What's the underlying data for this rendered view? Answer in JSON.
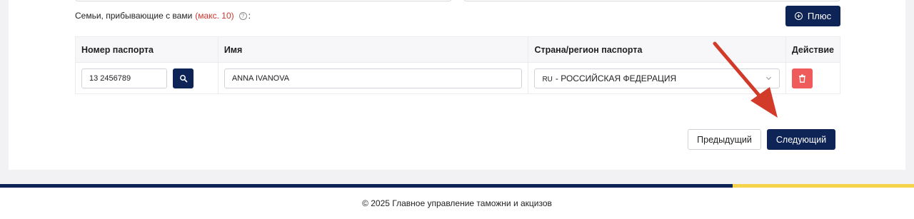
{
  "family_section": {
    "label": "Семьи, прибывающие с вами",
    "max_note": "(макс. 10)",
    "help_icon": "question-circle-icon",
    "colon": ":"
  },
  "plus_button": {
    "label": "Плюс",
    "icon": "plus-circle-icon"
  },
  "table": {
    "headers": {
      "passport_number": "Номер паспорта",
      "name": "Имя",
      "country": "Страна/регион паспорта",
      "action": "Действие"
    },
    "rows": [
      {
        "passport_number": "13 2456789",
        "name": "ANNA IVANOVA",
        "country_code": "RU",
        "country_name": "- РОССИЙСКАЯ ФЕДЕРАЦИЯ"
      }
    ]
  },
  "navigation": {
    "prev_label": "Предыдущий",
    "next_label": "Следующий"
  },
  "footer": {
    "text": "© 2025 Главное управление таможни и акцизов"
  },
  "colors": {
    "primary": "#0f2456",
    "danger": "#ef5b5b",
    "accent_red": "#d0352c",
    "footer_yellow": "#f4d24a",
    "annotation_arrow": "#d23a2a"
  }
}
